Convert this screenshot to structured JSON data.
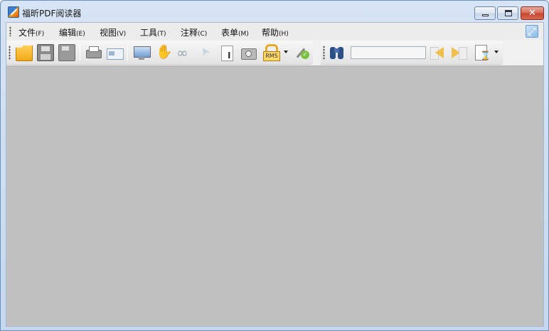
{
  "window": {
    "title": "福昕PDF阅读器"
  },
  "window_controls": {
    "minimize": "minimize",
    "maximize": "maximize",
    "close": "✕"
  },
  "menubar": {
    "items": [
      {
        "label": "文件",
        "accel": "(F)"
      },
      {
        "label": "编辑",
        "accel": "(E)"
      },
      {
        "label": "视图",
        "accel": "(V)"
      },
      {
        "label": "工具",
        "accel": "(T)"
      },
      {
        "label": "注释",
        "accel": "(C)"
      },
      {
        "label": "表单",
        "accel": "(M)"
      },
      {
        "label": "帮助",
        "accel": "(H)"
      }
    ]
  },
  "toolbar": {
    "icons": [
      "open-folder-icon",
      "save-icon",
      "save-as-icon",
      "print-icon",
      "email-card-icon",
      "fullscreen-monitor-icon",
      "hand-tool-icon",
      "zoom-glasses-icon",
      "select-pointer-icon",
      "text-select-icon",
      "snapshot-camera-icon",
      "rms-lock-icon",
      "sign-check-icon"
    ],
    "rms_label": "RMS"
  },
  "findbar": {
    "search_value": "",
    "icons": [
      "binoculars-icon",
      "find-previous-icon",
      "find-next-icon",
      "advanced-search-icon"
    ]
  },
  "colors": {
    "document_background": "#c0c0c0",
    "titlebar": "#d6e4f5",
    "close_button": "#c64530"
  }
}
